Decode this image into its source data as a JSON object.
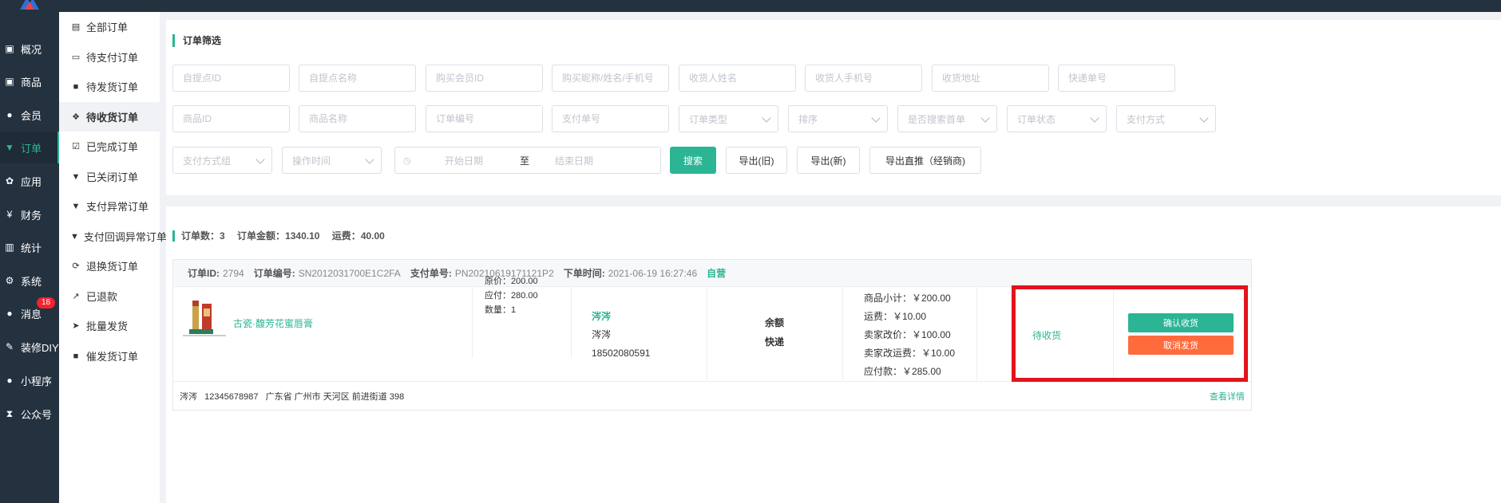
{
  "nav": {
    "items": [
      {
        "label": "概况",
        "icon": "dashboard-icon"
      },
      {
        "label": "商品",
        "icon": "goods-icon"
      },
      {
        "label": "会员",
        "icon": "members-icon"
      },
      {
        "label": "订单",
        "icon": "cart-icon",
        "active": true
      },
      {
        "label": "应用",
        "icon": "apps-icon"
      },
      {
        "label": "财务",
        "icon": "yen-icon"
      },
      {
        "label": "统计",
        "icon": "stats-icon"
      },
      {
        "label": "系统",
        "icon": "gears-icon"
      },
      {
        "label": "消息",
        "icon": "message-icon",
        "badge": "18"
      },
      {
        "label": "装修DIY",
        "icon": "wrench-icon"
      },
      {
        "label": "小程序",
        "icon": "wechat-icon"
      },
      {
        "label": "公众号",
        "icon": "hourglass-icon"
      }
    ]
  },
  "subnav": {
    "items": [
      {
        "label": "全部订单",
        "icon": "copy-icon"
      },
      {
        "label": "待支付订单",
        "icon": "card-icon"
      },
      {
        "label": "待发货订单",
        "icon": "truck-icon"
      },
      {
        "label": "待收货订单",
        "icon": "dropbox-icon",
        "active": true
      },
      {
        "label": "已完成订单",
        "icon": "check-square-icon"
      },
      {
        "label": "已关闭订单",
        "icon": "cup-icon"
      },
      {
        "label": "支付异常订单",
        "icon": "cup-icon"
      },
      {
        "label": "支付回调异常订单",
        "icon": "cup-icon"
      },
      {
        "label": "退换货订单",
        "icon": "refresh-icon"
      },
      {
        "label": "已退款",
        "icon": "share-icon"
      },
      {
        "label": "批量发货",
        "icon": "send-icon"
      },
      {
        "label": "催发货订单",
        "icon": "truck-icon"
      }
    ]
  },
  "filter": {
    "title": "订单筛选",
    "placeholders": {
      "pickup_id": "自提点ID",
      "pickup_name": "自提点名称",
      "buyer_id": "购买会员ID",
      "buyer_info": "购买昵称/姓名/手机号",
      "receiver_name": "收货人姓名",
      "receiver_phone": "收货人手机号",
      "address": "收货地址",
      "express_no": "快递单号",
      "goods_id": "商品ID",
      "goods_name": "商品名称",
      "order_no": "订单编号",
      "pay_no": "支付单号"
    },
    "selects": {
      "order_type": "订单类型",
      "sort": "排序",
      "first_order": "是否搜索首单",
      "order_status": "订单状态",
      "pay_method": "支付方式",
      "pay_group": "支付方式组",
      "op_time": "操作时间"
    },
    "date": {
      "start": "开始日期",
      "sep": "至",
      "end": "结束日期"
    },
    "buttons": {
      "search": "搜索",
      "export_old": "导出(旧)",
      "export_new": "导出(新)",
      "export_direct": "导出直推（经销商)"
    }
  },
  "summary": {
    "count_label": "订单数：",
    "count": "3",
    "amount_label": "订单金额：",
    "amount": "1340.10",
    "freight_label": "运费：",
    "freight": "40.00"
  },
  "order": {
    "id_label": "订单ID:",
    "id": "2794",
    "no_label": "订单编号:",
    "no": "SN2012031700E1C2FA",
    "pay_label": "支付单号:",
    "pay_no": "PN20210619171121P2",
    "time_label": "下单时间:",
    "time": "2021-06-19 16:27:46",
    "tag": "自营",
    "goods_name": "古瓷·馥芳花蜜唇膏",
    "orig_price": "原价：200.00",
    "payable": "应付：280.00",
    "qty": "数量：1",
    "buyer_nick": "涔涔",
    "buyer_name": "涔涔",
    "buyer_phone": "18502080591",
    "pay_type": "余额",
    "delivery": "快递",
    "subtotal": "商品小计：￥200.00",
    "freight": "运费：￥10.00",
    "seller_price": "卖家改价：￥100.00",
    "seller_freight": "卖家改运费：￥10.00",
    "payable_total": "应付款：￥285.00",
    "status": "待收货",
    "confirm": "确认收货",
    "cancel": "取消发货",
    "address": "涔涔   12345678987   广东省 广州市 天河区 前进街道 398",
    "detail": "查看详情"
  }
}
